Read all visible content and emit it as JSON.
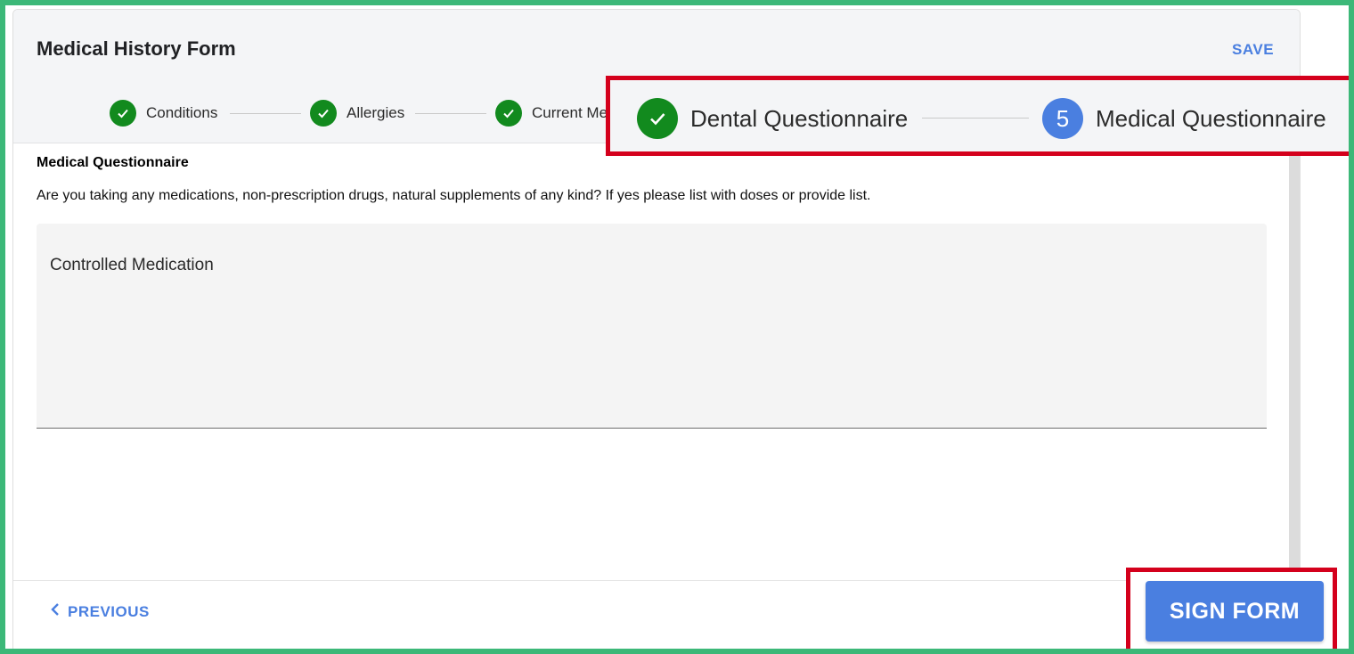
{
  "header": {
    "title": "Medical History Form",
    "save_label": "SAVE"
  },
  "stepper": {
    "steps": [
      {
        "label": "Conditions",
        "status": "completed",
        "icon": "check-icon"
      },
      {
        "label": "Allergies",
        "status": "completed",
        "icon": "check-icon"
      },
      {
        "label": "Current Me",
        "status": "completed",
        "icon": "check-icon"
      },
      {
        "label": "Dental Questionnaire",
        "status": "completed",
        "icon": "check-icon"
      },
      {
        "label": "Medical Questionnaire",
        "status": "current",
        "number": "5"
      }
    ]
  },
  "section": {
    "title": "Medical Questionnaire",
    "question": "Are you taking any medications, non-prescription drugs, natural supplements of any kind? If yes please list with doses or provide list.",
    "answer_value": "Controlled Medication"
  },
  "footer": {
    "previous_label": "PREVIOUS",
    "sign_label": "SIGN FORM"
  },
  "colors": {
    "accent": "#4a7fe0",
    "completed": "#128a1e",
    "highlight": "#d4001c",
    "frame": "#3cb878"
  }
}
